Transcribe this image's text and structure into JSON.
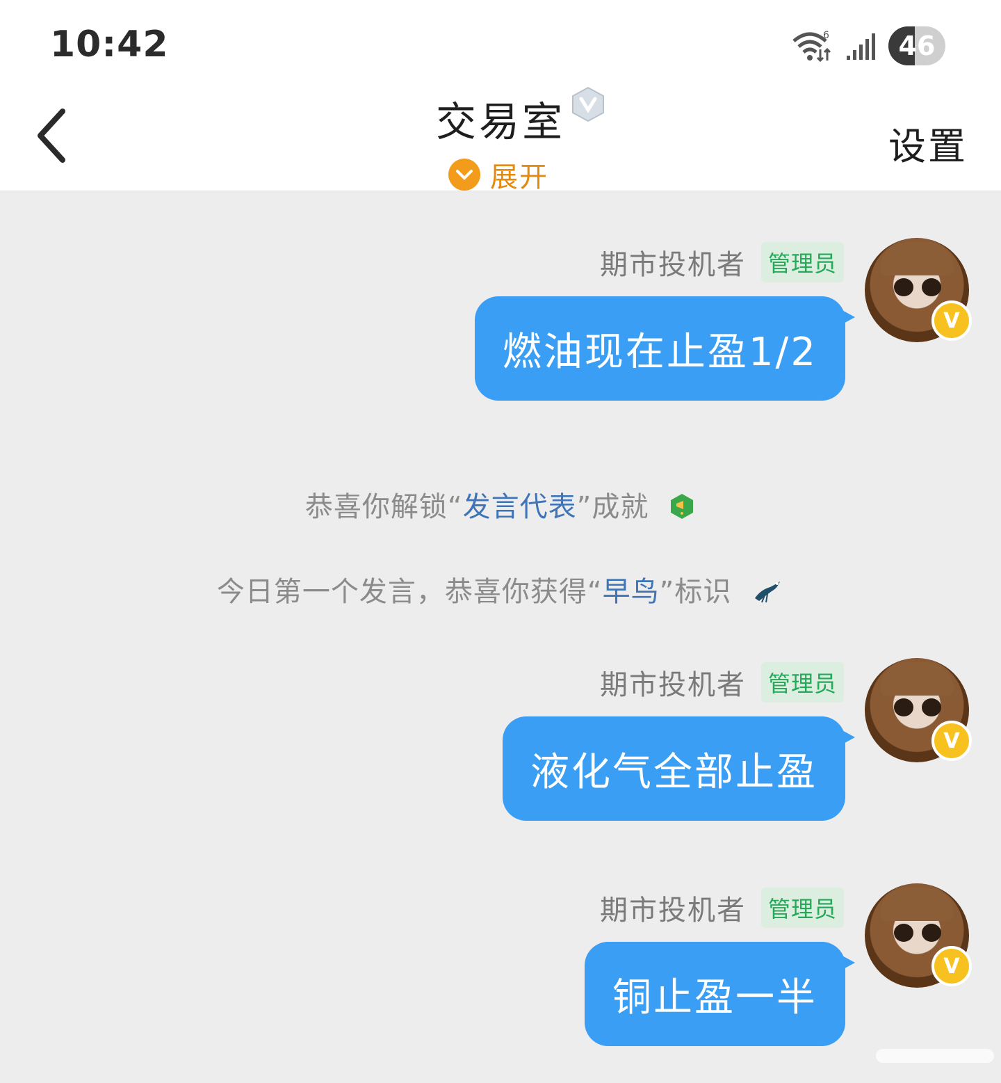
{
  "status_bar": {
    "time": "10:42",
    "battery": "46",
    "wifi_badge": "6"
  },
  "header": {
    "title": "交易室",
    "expand_label": "展开",
    "settings_label": "设置"
  },
  "messages": [
    {
      "sender": "期市投机者",
      "role": "管理员",
      "text": "燃油现在止盈1/2"
    },
    {
      "sender": "期市投机者",
      "role": "管理员",
      "text": "液化气全部止盈"
    },
    {
      "sender": "期市投机者",
      "role": "管理员",
      "text": "铜止盈一半"
    }
  ],
  "system": {
    "achievement": {
      "pre": "恭喜你解锁“",
      "hl": "发言代表",
      "post": "”成就"
    },
    "early_bird": {
      "pre": "今日第一个发言，恭喜你获得“",
      "hl": "早鸟",
      "post": "”标识"
    }
  },
  "colors": {
    "bubble": "#3a9ef5",
    "accent": "#f39c1b",
    "role_green": "#26a85a",
    "link_blue": "#3f75b8"
  }
}
